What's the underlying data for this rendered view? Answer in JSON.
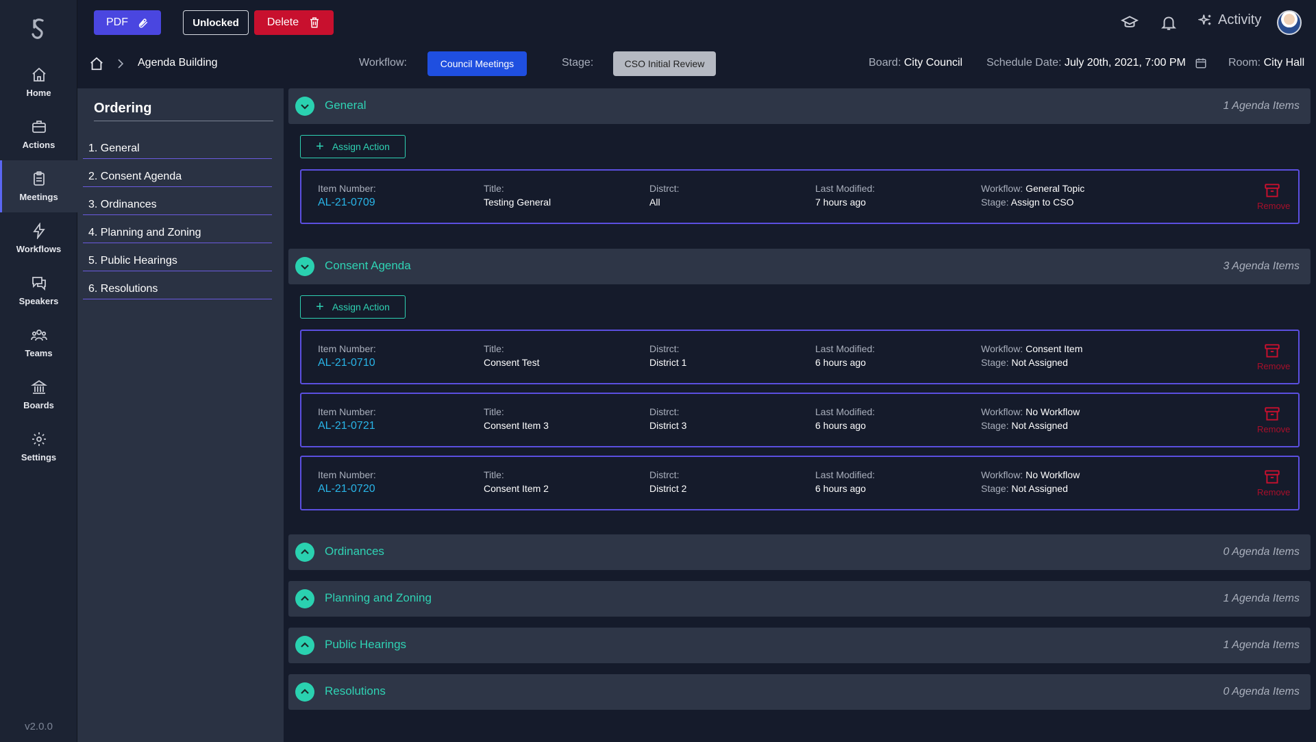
{
  "app": {
    "version": "v2.0.0"
  },
  "sidebar": {
    "items": [
      {
        "label": "Home",
        "icon": "home-icon"
      },
      {
        "label": "Actions",
        "icon": "briefcase-icon"
      },
      {
        "label": "Meetings",
        "icon": "clipboard-icon",
        "active": true
      },
      {
        "label": "Workflows",
        "icon": "bolt-icon"
      },
      {
        "label": "Speakers",
        "icon": "chat-icon"
      },
      {
        "label": "Teams",
        "icon": "users-icon"
      },
      {
        "label": "Boards",
        "icon": "building-icon"
      },
      {
        "label": "Settings",
        "icon": "gear-icon"
      }
    ]
  },
  "toolbar": {
    "pdf_label": "PDF",
    "unlocked_label": "Unlocked",
    "delete_label": "Delete",
    "activity_label": "Activity"
  },
  "breadcrumb": {
    "current": "Agenda Building"
  },
  "meta": {
    "workflow_label": "Workflow:",
    "workflow_value": "Council Meetings",
    "stage_label": "Stage:",
    "stage_value": "CSO Initial Review",
    "board_label": "Board:",
    "board_value": "City Council",
    "schedule_label": "Schedule Date:",
    "schedule_value": "July 20th, 2021, 7:00 PM",
    "room_label": "Room:",
    "room_value": "City Hall"
  },
  "ordering": {
    "title": "Ordering",
    "items": [
      "1. General",
      "2. Consent Agenda",
      "3. Ordinances",
      "4. Planning and Zoning",
      "5. Public Hearings",
      "6. Resolutions"
    ]
  },
  "labels": {
    "assign_action": "Assign Action",
    "item_number": "Item Number:",
    "title": "Title:",
    "district": "Distrct:",
    "last_modified": "Last Modified:",
    "workflow": "Workflow:",
    "stage": "Stage:",
    "remove": "Remove"
  },
  "sections": [
    {
      "title": "General",
      "count": "1 Agenda Items",
      "expanded": true,
      "items": [
        {
          "number": "AL-21-0709",
          "title": "Testing General",
          "district": "All",
          "modified": "7 hours ago",
          "workflow": "General Topic",
          "stage": "Assign to CSO"
        }
      ]
    },
    {
      "title": "Consent Agenda",
      "count": "3 Agenda Items",
      "expanded": true,
      "items": [
        {
          "number": "AL-21-0710",
          "title": "Consent Test",
          "district": "District 1",
          "modified": "6 hours ago",
          "workflow": "Consent Item",
          "stage": "Not Assigned"
        },
        {
          "number": "AL-21-0721",
          "title": "Consent Item 3",
          "district": "District 3",
          "modified": "6 hours ago",
          "workflow": "No Workflow",
          "stage": "Not Assigned"
        },
        {
          "number": "AL-21-0720",
          "title": "Consent Item 2",
          "district": "District 2",
          "modified": "6 hours ago",
          "workflow": "No Workflow",
          "stage": "Not Assigned"
        }
      ]
    },
    {
      "title": "Ordinances",
      "count": "0 Agenda Items",
      "expanded": false
    },
    {
      "title": "Planning and Zoning",
      "count": "1 Agenda Items",
      "expanded": false
    },
    {
      "title": "Public Hearings",
      "count": "1 Agenda Items",
      "expanded": false
    },
    {
      "title": "Resolutions",
      "count": "0 Agenda Items",
      "expanded": false
    }
  ],
  "colors": {
    "accent": "#2fd3b4",
    "primary": "#4a46e0",
    "danger": "#c8102e",
    "card_border": "#5b4fe0",
    "item_link": "#29b5e8"
  }
}
